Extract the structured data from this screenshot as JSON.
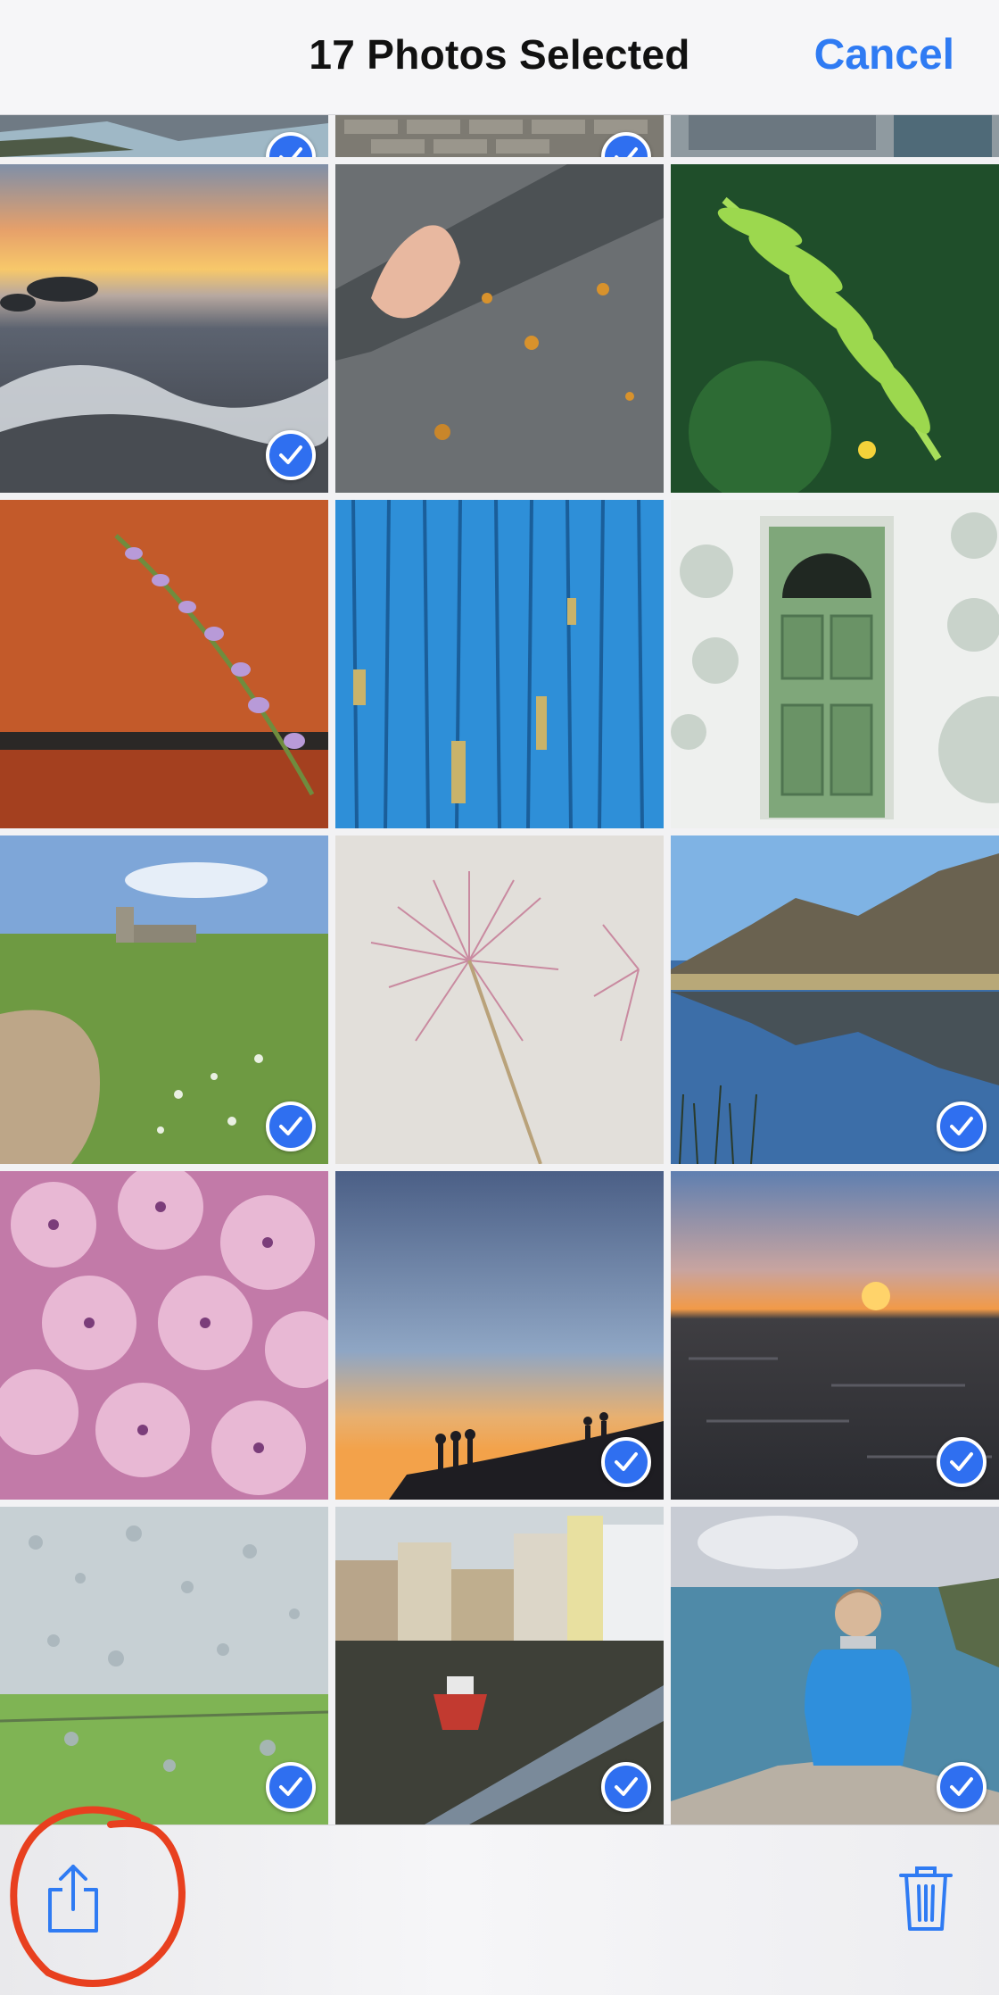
{
  "header": {
    "title": "17 Photos Selected",
    "cancel_label": "Cancel"
  },
  "toolbar": {
    "share_icon": "share-icon",
    "trash_icon": "trash-icon"
  },
  "annotation": {
    "circle_color": "#e8401f",
    "circled": "share-button"
  },
  "photos": [
    {
      "subject": "coast rocks",
      "selected": true
    },
    {
      "subject": "stone wall",
      "selected": true
    },
    {
      "subject": "door",
      "selected": false
    },
    {
      "subject": "sunset waves",
      "selected": true
    },
    {
      "subject": "hand on rock",
      "selected": false
    },
    {
      "subject": "fern",
      "selected": false
    },
    {
      "subject": "lavender on red wall",
      "selected": false
    },
    {
      "subject": "blue peeling paint",
      "selected": false
    },
    {
      "subject": "green door",
      "selected": false
    },
    {
      "subject": "church path",
      "selected": true
    },
    {
      "subject": "allium",
      "selected": false
    },
    {
      "subject": "mountain lake",
      "selected": true
    },
    {
      "subject": "pink hydrangea",
      "selected": false
    },
    {
      "subject": "silhouettes at dusk",
      "selected": true
    },
    {
      "subject": "sea sunset",
      "selected": true
    },
    {
      "subject": "rain on window",
      "selected": true
    },
    {
      "subject": "harbour boats",
      "selected": true
    },
    {
      "subject": "person on cliff",
      "selected": true
    }
  ],
  "colors": {
    "accent": "#2f7bf3",
    "check": "#2f6ff0"
  }
}
